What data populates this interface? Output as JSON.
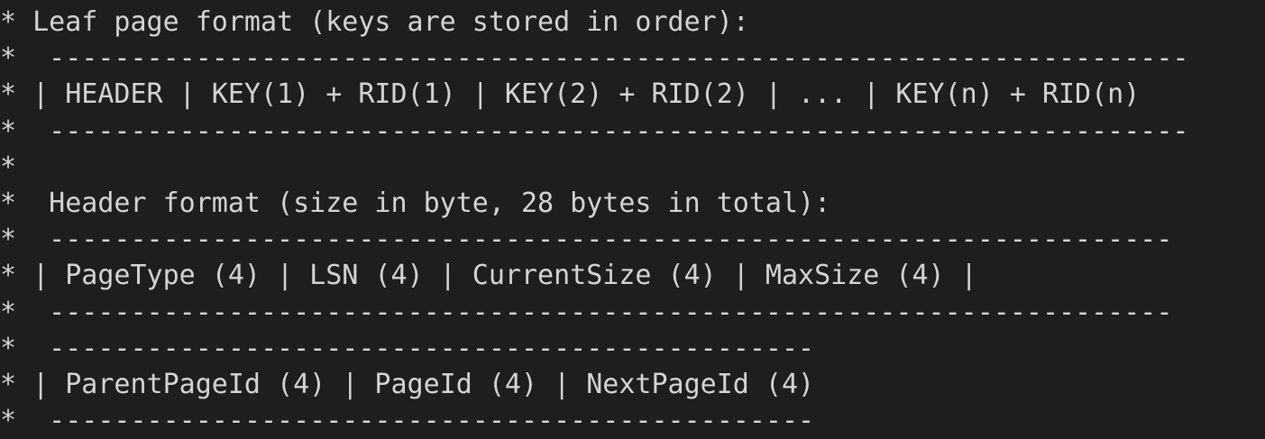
{
  "code_comment": {
    "lines": [
      "* Leaf page format (keys are stored in order):",
      "*  ----------------------------------------------------------------------",
      "* | HEADER | KEY(1) + RID(1) | KEY(2) + RID(2) | ... | KEY(n) + RID(n)",
      "*  ----------------------------------------------------------------------",
      "*",
      "*  Header format (size in byte, 28 bytes in total):",
      "*  ---------------------------------------------------------------------",
      "* | PageType (4) | LSN (4) | CurrentSize (4) | MaxSize (4) |",
      "*  ---------------------------------------------------------------------",
      "*  -----------------------------------------------",
      "* | ParentPageId (4) | PageId (4) | NextPageId (4)",
      "*  -----------------------------------------------"
    ]
  },
  "colors": {
    "background": "#1e1e1e",
    "text": "#d4d4d4"
  }
}
